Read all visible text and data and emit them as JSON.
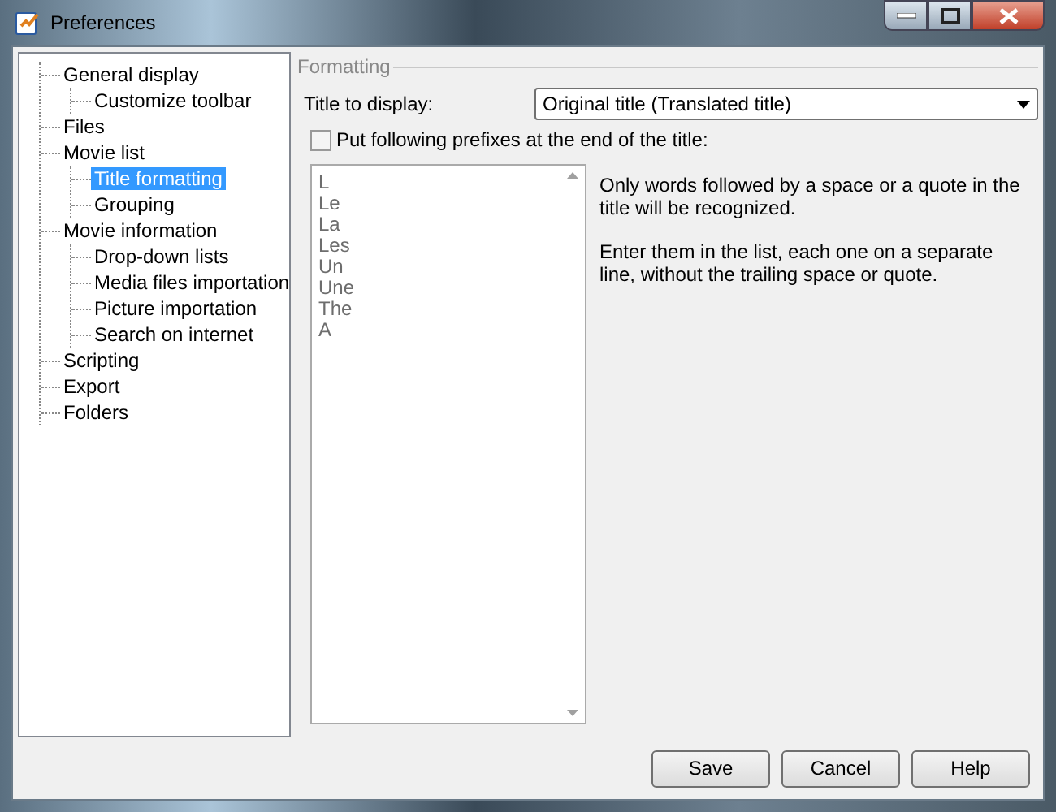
{
  "window": {
    "title": "Preferences"
  },
  "sidebar": {
    "items": [
      {
        "label": "General display",
        "selected": false,
        "children": [
          {
            "label": "Customize toolbar",
            "selected": false
          }
        ]
      },
      {
        "label": "Files",
        "selected": false
      },
      {
        "label": "Movie list",
        "selected": false,
        "children": [
          {
            "label": "Title formatting",
            "selected": true
          },
          {
            "label": "Grouping",
            "selected": false
          }
        ]
      },
      {
        "label": "Movie information",
        "selected": false,
        "children": [
          {
            "label": "Drop-down lists",
            "selected": false
          },
          {
            "label": "Media files importation",
            "selected": false
          },
          {
            "label": "Picture importation",
            "selected": false
          },
          {
            "label": "Search on internet",
            "selected": false
          }
        ]
      },
      {
        "label": "Scripting",
        "selected": false
      },
      {
        "label": "Export",
        "selected": false
      },
      {
        "label": "Folders",
        "selected": false
      }
    ]
  },
  "formatting": {
    "group_title": "Formatting",
    "title_label": "Title to display:",
    "title_value": "Original title (Translated title)",
    "prefix_checkbox": {
      "label": "Put following prefixes at the end of the title:",
      "checked": false
    },
    "prefixes": {
      "disabled": true,
      "items": [
        "L",
        "Le",
        "La",
        "Les",
        "Un",
        "Une",
        "The",
        "A"
      ]
    },
    "help_texts": [
      "Only words followed by a space or a quote in the title will be recognized.",
      "Enter them in the list, each one on a separate line, without the trailing space or quote."
    ]
  },
  "buttons": [
    "Save",
    "Cancel",
    "Help"
  ]
}
